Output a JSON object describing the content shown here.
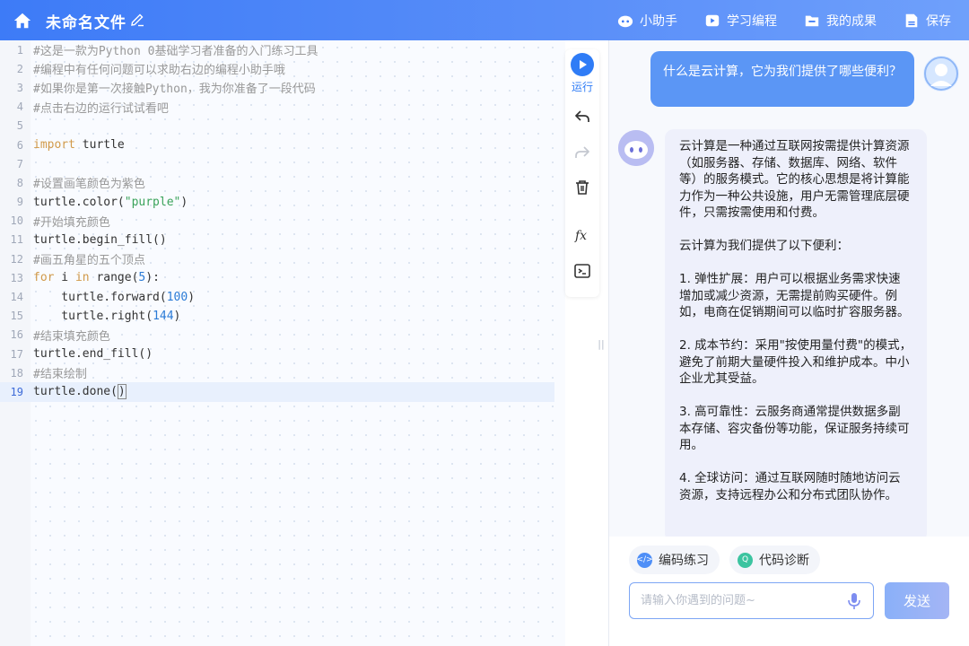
{
  "header": {
    "file_title": "未命名文件",
    "actions": [
      {
        "label": "小助手",
        "icon": "assistant-icon"
      },
      {
        "label": "学习编程",
        "icon": "play-video-icon"
      },
      {
        "label": "我的成果",
        "icon": "folder-icon"
      },
      {
        "label": "保存",
        "icon": "save-icon"
      }
    ]
  },
  "editor": {
    "active_line": 19,
    "lines": [
      {
        "n": "1",
        "text": "#这是一款为Python 0基础学习者准备的入门练习工具"
      },
      {
        "n": "2",
        "text": "#编程中有任何问题可以求助右边的编程小助手哦"
      },
      {
        "n": "3",
        "text": "#如果你是第一次接触Python，我为你准备了一段代码"
      },
      {
        "n": "4",
        "text": "#点击右边的运行试试看吧"
      },
      {
        "n": "5",
        "text": ""
      },
      {
        "n": "6",
        "text": "import turtle"
      },
      {
        "n": "7",
        "text": ""
      },
      {
        "n": "8",
        "text": "#设置画笔颜色为紫色"
      },
      {
        "n": "9",
        "text": "turtle.color(\"purple\")"
      },
      {
        "n": "10",
        "text": "#开始填充颜色"
      },
      {
        "n": "11",
        "text": "turtle.begin_fill()"
      },
      {
        "n": "12",
        "text": "#画五角星的五个顶点"
      },
      {
        "n": "13",
        "text": "for i in range(5):"
      },
      {
        "n": "14",
        "text": "    turtle.forward(100)"
      },
      {
        "n": "15",
        "text": "    turtle.right(144)"
      },
      {
        "n": "16",
        "text": "#结束填充颜色"
      },
      {
        "n": "17",
        "text": "turtle.end_fill()"
      },
      {
        "n": "18",
        "text": "#结束绘制"
      },
      {
        "n": "19",
        "text": "turtle.done()"
      }
    ]
  },
  "toolbar": {
    "run_label": "运行",
    "tools": [
      "undo-icon",
      "redo-icon",
      "trash-icon",
      "function-icon",
      "terminal-icon"
    ]
  },
  "chat": {
    "user_message": "什么是云计算，它为我们提供了哪些便利？",
    "bot_paragraphs": [
      "云计算是一种通过互联网按需提供计算资源（如服务器、存储、数据库、网络、软件等）的服务模式。它的核心思想是将计算能力作为一种公共设施，用户无需管理底层硬件，只需按需使用和付费。",
      "云计算为我们提供了以下便利：",
      "1. 弹性扩展：用户可以根据业务需求快速增加或减少资源，无需提前购买硬件。例如，电商在促销期间可以临时扩容服务器。",
      "2. 成本节约：采用\"按使用量付费\"的模式，避免了前期大量硬件投入和维护成本。中小企业尤其受益。",
      "3. 高可靠性：云服务商通常提供数据多副本存储、容灾备份等功能，保证服务持续可用。",
      "4. 全球访问：通过互联网随时随地访问云资源，支持远程办公和分布式团队协作。"
    ],
    "chips": [
      {
        "label": "编码练习",
        "color": "#4f8ff7"
      },
      {
        "label": "代码诊断",
        "color": "#3cc4a0"
      }
    ],
    "input_placeholder": "请输入你遇到的问题~",
    "send_label": "发送"
  },
  "colors": {
    "header_bg": "#3d7bf7",
    "accent": "#2f7cf6",
    "user_bubble": "#5b96f5",
    "bot_bubble": "#eef0fb"
  }
}
